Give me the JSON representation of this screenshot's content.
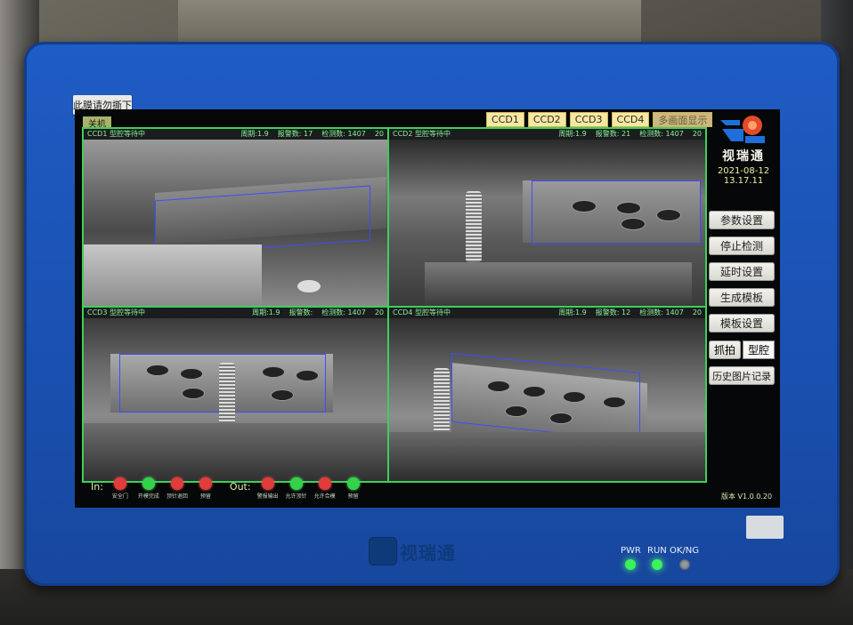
{
  "monitor": {
    "sticker_text": "此膜请勿撕下",
    "bezel_brand": "视瑞通",
    "leds": [
      {
        "label": "PWR",
        "state": "on"
      },
      {
        "label": "RUN",
        "state": "on"
      },
      {
        "label": "OK/NG",
        "state": "off"
      }
    ]
  },
  "screen": {
    "power_button": "关机",
    "ccd_tabs": [
      "CCD1",
      "CCD2",
      "CCD3",
      "CCD4",
      "多画面显示"
    ],
    "cameras": [
      {
        "name": "CCD1 型腔等待中",
        "period": "周期:1.9",
        "alarms": "报警数: 17",
        "inspections": "检测数: 1407",
        "count": "20"
      },
      {
        "name": "CCD2 型腔等待中",
        "period": "周期:1.9",
        "alarms": "报警数: 21",
        "inspections": "检测数: 1407",
        "count": "20"
      },
      {
        "name": "CCD3 型腔等待中",
        "period": "周期:1.9",
        "alarms": "报警数:",
        "inspections": "检测数: 1407",
        "count": "20"
      },
      {
        "name": "CCD4 型腔等待中",
        "period": "周期:1.9",
        "alarms": "报警数: 12",
        "inspections": "检测数: 1407",
        "count": "20"
      }
    ],
    "io": {
      "in_label": "In:",
      "out_label": "Out:",
      "inputs": [
        {
          "label": "安全门",
          "state": "red"
        },
        {
          "label": "开模完成",
          "state": "green"
        },
        {
          "label": "顶针退回",
          "state": "red"
        },
        {
          "label": "预留",
          "state": "red"
        }
      ],
      "outputs": [
        {
          "label": "警报输出",
          "state": "red"
        },
        {
          "label": "允许顶针",
          "state": "green"
        },
        {
          "label": "允许合模",
          "state": "red"
        },
        {
          "label": "预留",
          "state": "green"
        }
      ]
    },
    "sidebar": {
      "brand": "视瑞通",
      "date": "2021-08-12",
      "time": "13.17.11",
      "buttons": [
        "参数设置",
        "停止检测",
        "延时设置",
        "生成模板",
        "模板设置"
      ],
      "capture_button": "抓拍",
      "cavity_select": "型腔",
      "history_button": "历史图片记录"
    },
    "version": "版本 V1.0.0.20"
  }
}
